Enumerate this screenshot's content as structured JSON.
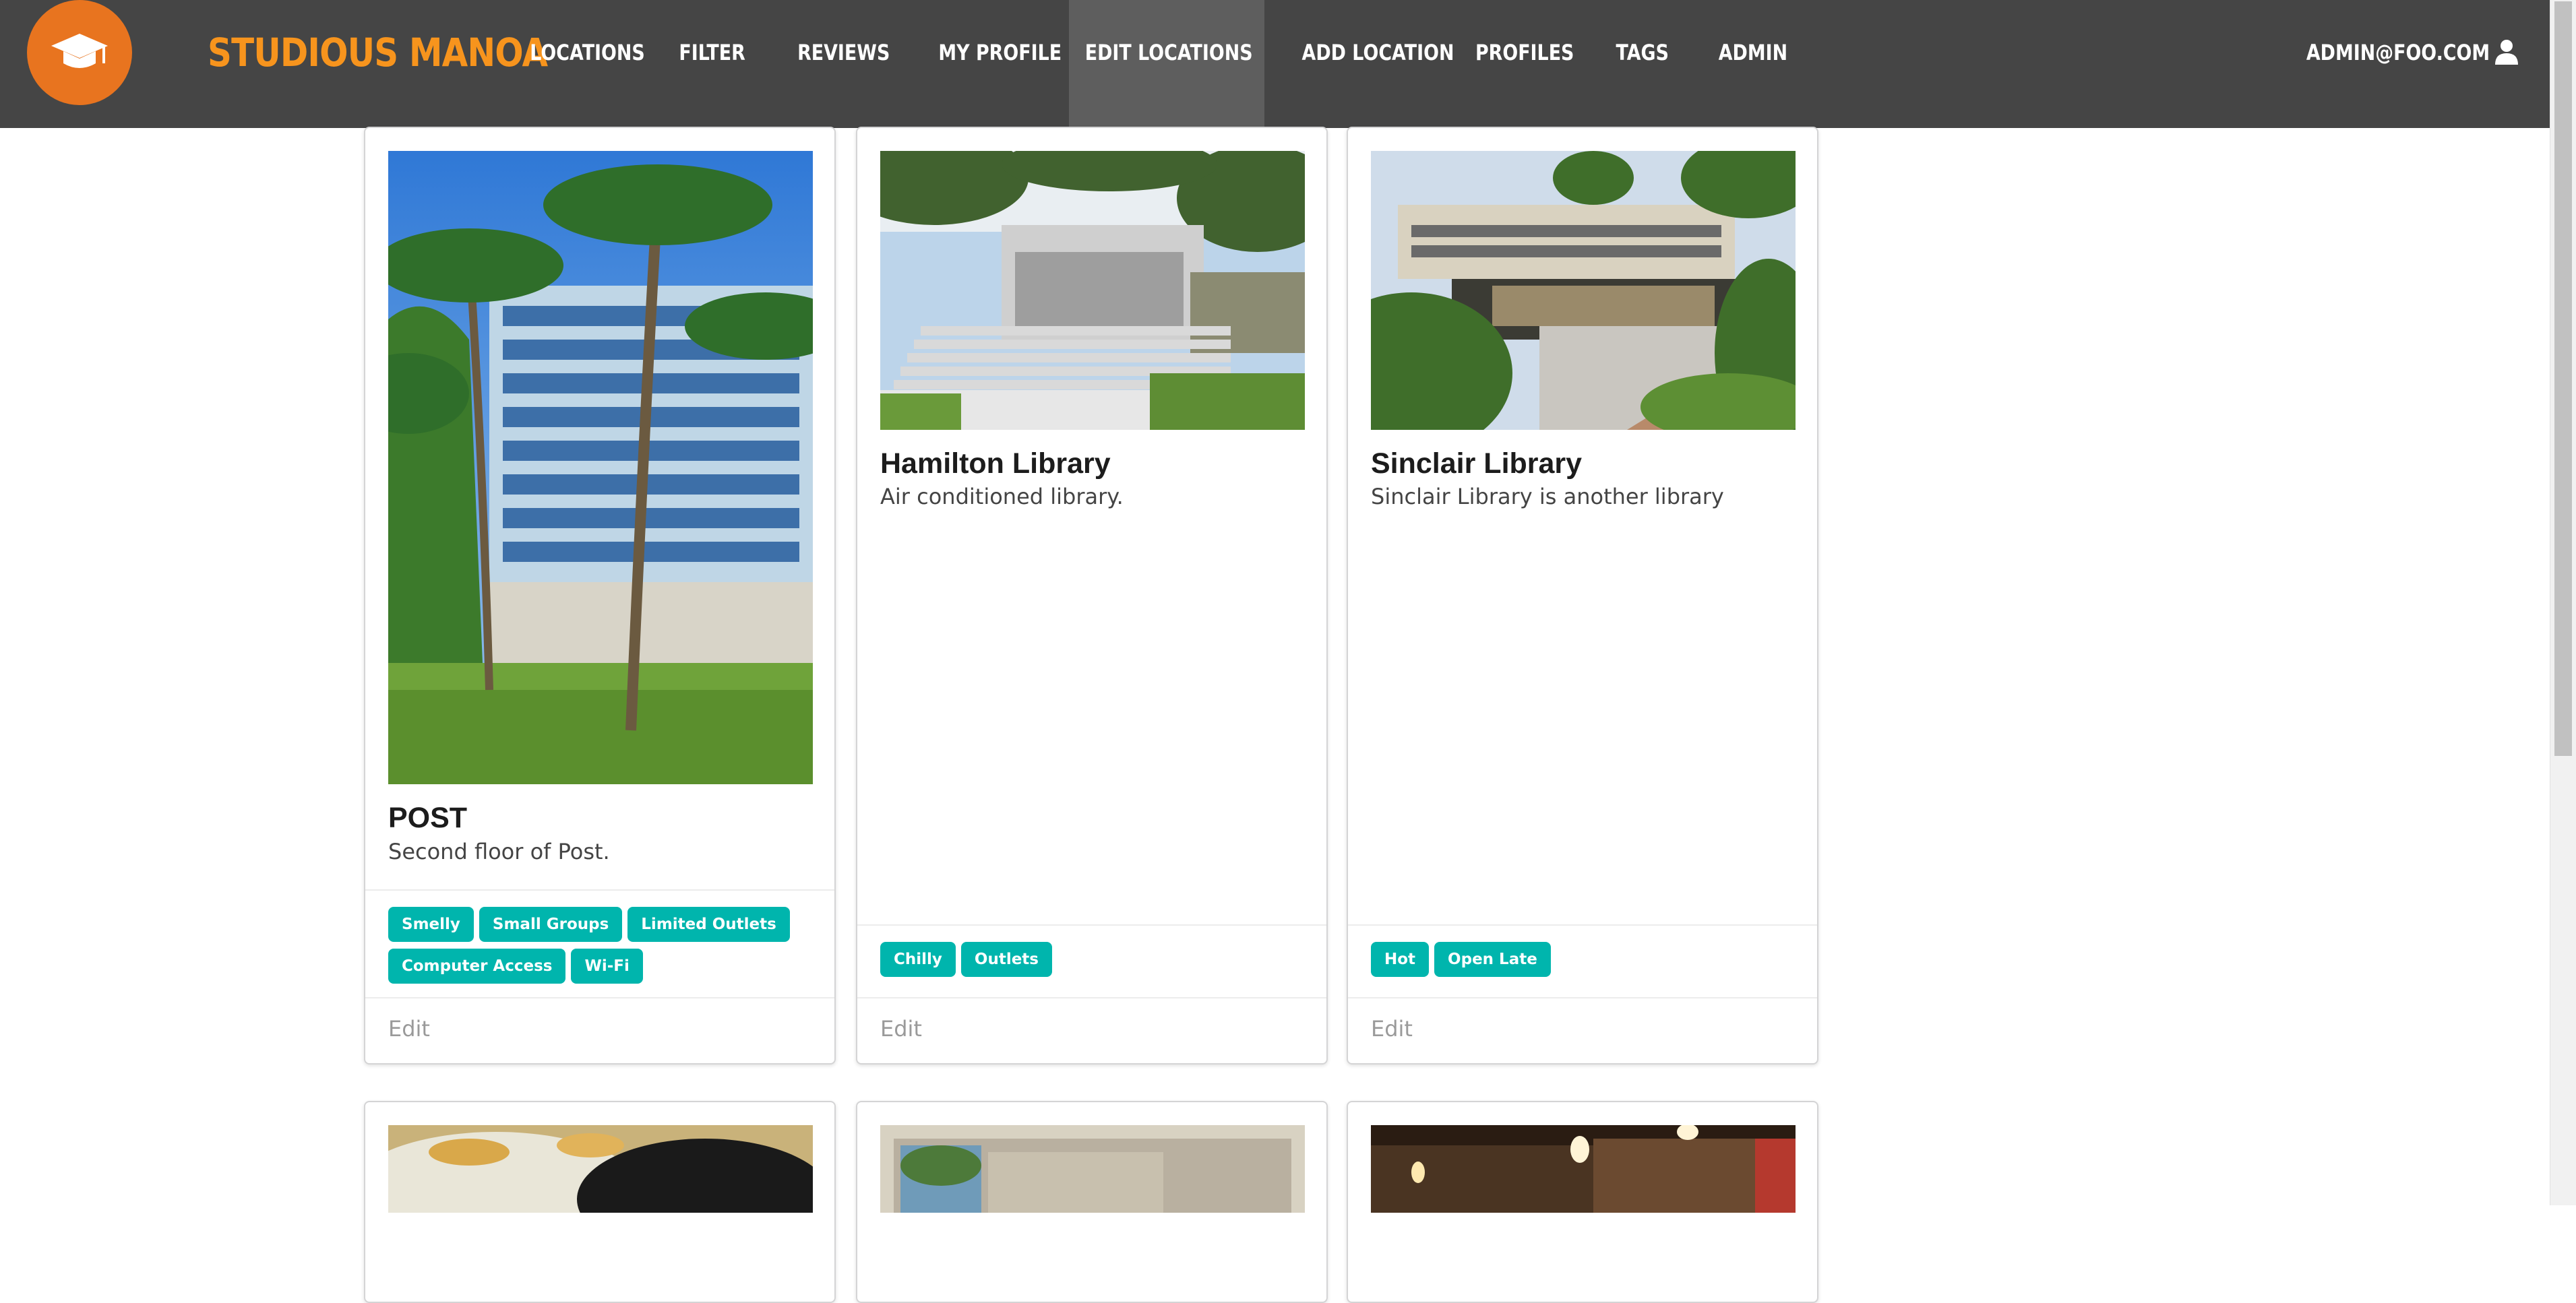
{
  "brand": "STUDIOUS MANOA",
  "nav": [
    {
      "label": "LOCATIONS",
      "active": false
    },
    {
      "label": "FILTER",
      "active": false
    },
    {
      "label": "REVIEWS",
      "active": false
    },
    {
      "label": "MY PROFILE",
      "active": false
    },
    {
      "label": "EDIT LOCATIONS",
      "active": true
    },
    {
      "label": "ADD LOCATION",
      "active": false
    },
    {
      "label": "PROFILES",
      "active": false
    },
    {
      "label": "TAGS",
      "active": false
    },
    {
      "label": "ADMIN",
      "active": false
    }
  ],
  "user": {
    "email": "ADMIN@FOO.COM",
    "icon": "user-icon"
  },
  "colors": {
    "navbar": "#454545",
    "brand": "#f7941d",
    "logo": "#e8741f",
    "tag": "#00b5ad"
  },
  "cards": [
    {
      "title": "POST",
      "description": "Second floor of Post.",
      "tags": [
        "Smelly",
        "Small Groups",
        "Limited Outlets",
        "Computer Access",
        "Wi-Fi"
      ],
      "action": "Edit"
    },
    {
      "title": "Hamilton Library",
      "description": "Air conditioned library.",
      "tags": [
        "Chilly",
        "Outlets"
      ],
      "action": "Edit"
    },
    {
      "title": "Sinclair Library",
      "description": "Sinclair Library is another library",
      "tags": [
        "Hot",
        "Open Late"
      ],
      "action": "Edit"
    }
  ]
}
